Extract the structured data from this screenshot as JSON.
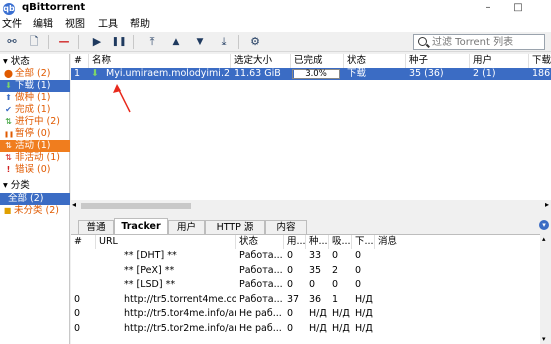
{
  "window": {
    "title": "qBittorrent",
    "app_icon": "qb",
    "minimize": "–",
    "maximize": "□"
  },
  "menu": [
    "文件",
    "编辑",
    "视图",
    "工具",
    "帮助"
  ],
  "toolbar": {
    "icons": [
      "link-icon",
      "add-file-icon",
      "remove-icon",
      "resume-icon",
      "pause-icon",
      "top-priority-icon",
      "up-icon",
      "down-icon",
      "bottom-priority-icon",
      "options-icon"
    ],
    "glyphs": {
      "link": "⚯",
      "add": "🗋",
      "remove": "—",
      "resume": "▶",
      "pause": "❚❚",
      "top": "⤒",
      "up": "▲",
      "down": "▼",
      "bottom": "⤓",
      "options": "⚙"
    },
    "search_placeholder": "过滤 Torrent 列表"
  },
  "sidebar": {
    "status_header": "▾ 状态",
    "status": [
      {
        "label": "全部 (2)",
        "color": "#e05a00",
        "icon": "⬤"
      },
      {
        "label": "下载 (1)",
        "color": "#ffffff",
        "icon": "⬇",
        "selected": "blue"
      },
      {
        "label": "做种 (1)",
        "color": "#e05a00",
        "icon": "⬆"
      },
      {
        "label": "完成 (1)",
        "color": "#e05a00",
        "icon": "✔"
      },
      {
        "label": "进行中 (2)",
        "color": "#e05a00",
        "icon": "⇅"
      },
      {
        "label": "暂停 (0)",
        "color": "#e05a00",
        "icon": "❚❚"
      },
      {
        "label": "活动 (1)",
        "color": "#ffffff",
        "icon": "⇅",
        "selected": "orange"
      },
      {
        "label": "非活动 (1)",
        "color": "#e05a00",
        "icon": "⇅"
      },
      {
        "label": "错误 (0)",
        "color": "#e05a00",
        "icon": "!"
      }
    ],
    "category_header": "▾ 分类",
    "categories": [
      {
        "label": "全部 (2)",
        "selected": "blue"
      },
      {
        "label": "未分类 (2)",
        "color": "#e05a00"
      }
    ]
  },
  "torrent_table": {
    "headers": [
      "#",
      "名称",
      "选定大小",
      "已完成",
      "状态",
      "种子",
      "用户",
      "下载"
    ],
    "rows": [
      {
        "num": "1",
        "name": "Myi.umiraem.molodyimi.2...",
        "size": "11.63 GiB",
        "progress": 3.0,
        "progress_label": "3.0%",
        "status": "下载",
        "seeds": "35 (36)",
        "peers": "2 (1)",
        "down": "186."
      }
    ]
  },
  "detail_tabs": [
    "普通",
    "Tracker",
    "用户",
    "HTTP 源",
    "内容"
  ],
  "active_tab": 1,
  "tracker_table": {
    "headers": [
      "#",
      "URL",
      "状态",
      "用...",
      "种...",
      "吸...",
      "下...",
      "消息"
    ],
    "rows": [
      {
        "num": "",
        "url": "** [DHT] **",
        "status": "Работа...",
        "users": "0",
        "seeds": "33",
        "leech": "0",
        "down": "0",
        "msg": ""
      },
      {
        "num": "",
        "url": "** [PeX] **",
        "status": "Работа...",
        "users": "0",
        "seeds": "35",
        "leech": "2",
        "down": "0",
        "msg": ""
      },
      {
        "num": "",
        "url": "** [LSD] **",
        "status": "Работа...",
        "users": "0",
        "seeds": "0",
        "leech": "0",
        "down": "0",
        "msg": ""
      },
      {
        "num": "0",
        "url": "http://tr5.torrent4me.com/an...",
        "status": "Работа...",
        "users": "37",
        "seeds": "36",
        "leech": "1",
        "down": "Н/Д",
        "msg": ""
      },
      {
        "num": "0",
        "url": "http://tr5.tor4me.info/announ...",
        "status": "Не раб...",
        "users": "0",
        "seeds": "Н/Д",
        "leech": "Н/Д",
        "down": "Н/Д",
        "msg": ""
      },
      {
        "num": "0",
        "url": "http://tr5.tor2me.info/announ...",
        "status": "Не раб...",
        "users": "0",
        "seeds": "Н/Д",
        "leech": "Н/Д",
        "down": "Н/Д",
        "msg": ""
      }
    ]
  },
  "colors": {
    "selection": "#3b6cc4",
    "active_orange": "#f07d1e",
    "status_orange": "#e05a00",
    "annotation_arrow": "#e8291c"
  }
}
